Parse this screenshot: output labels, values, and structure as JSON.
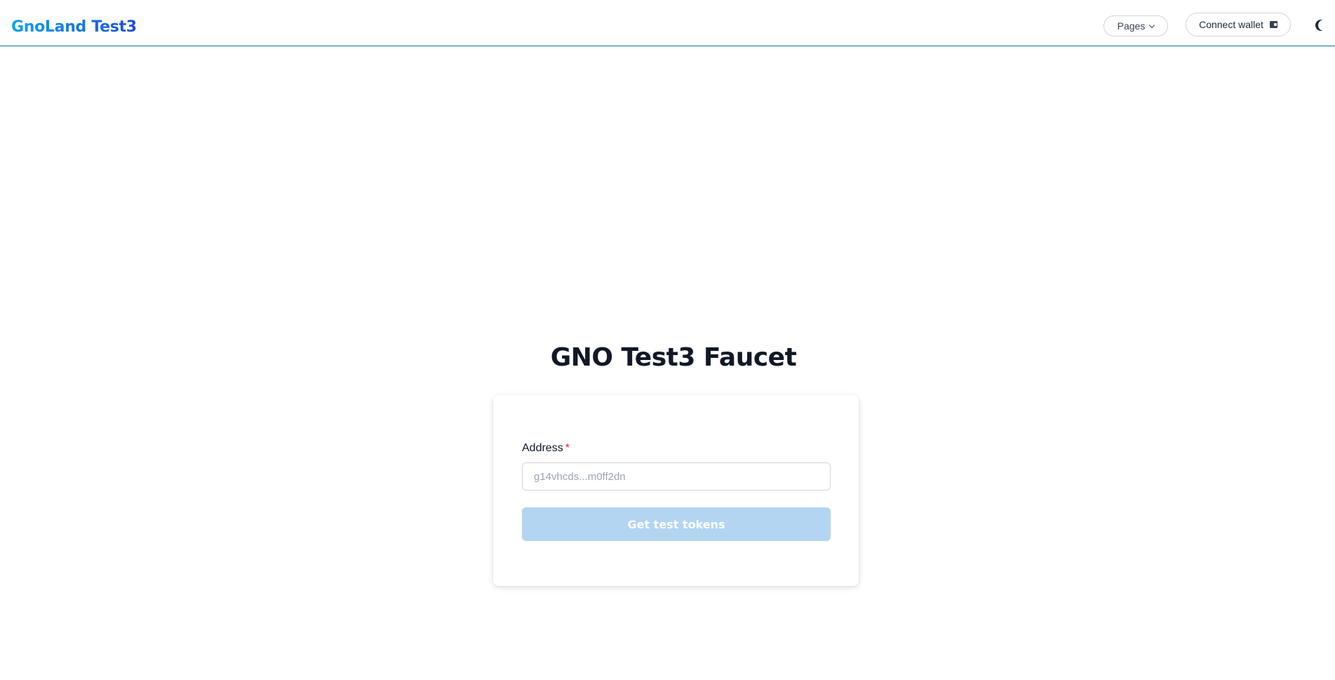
{
  "header": {
    "brand": "GnoLand Test3",
    "pages_label": "Pages",
    "connect_wallet_label": "Connect wallet",
    "icons": {
      "pages": "chevron-down-icon",
      "wallet": "wallet-icon",
      "theme": "moon-icon"
    },
    "colors": {
      "brand_gradient_start": "#0ea5e9",
      "brand_gradient_end": "#1d4ed8",
      "header_border": "#0e7490"
    }
  },
  "main": {
    "title": "GNO Test3 Faucet",
    "form": {
      "address_label": "Address",
      "required_mark": "*",
      "address_value": "",
      "address_placeholder": "g14vhcds...m0ff2dn",
      "submit_label": "Get test tokens",
      "submit_color": "#b3d5f2"
    }
  }
}
